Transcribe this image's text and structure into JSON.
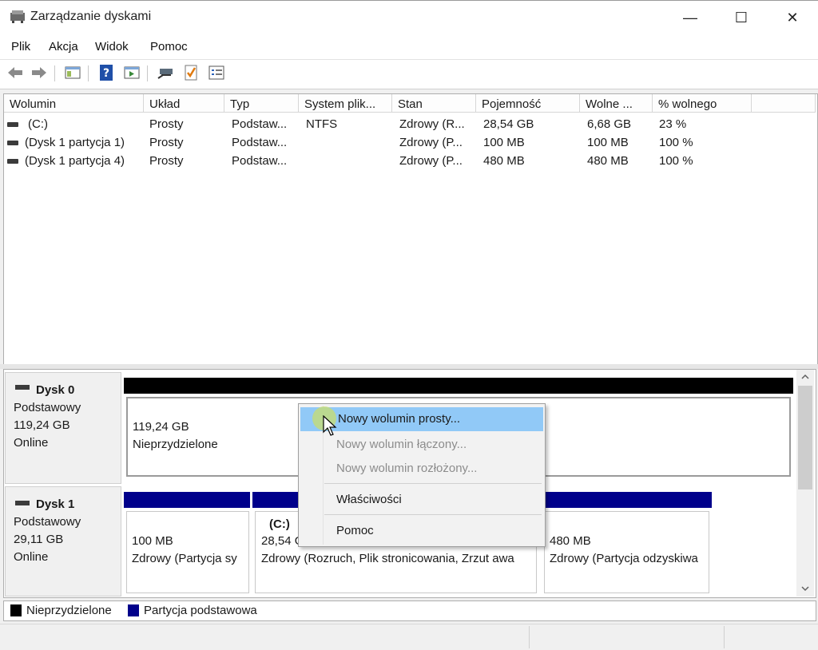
{
  "window": {
    "title": "Zarządzanie dyskami",
    "minimize": "—",
    "maximize": "☐",
    "close": "✕"
  },
  "menu": [
    "Plik",
    "Akcja",
    "Widok",
    "Pomoc"
  ],
  "toolbar_icons": [
    "back-arrow-icon",
    "forward-arrow-icon",
    "console-tree-icon",
    "help-icon",
    "action-pane-icon",
    "connect-icon",
    "check-icon",
    "properties-icon"
  ],
  "table": {
    "columns": [
      "Wolumin",
      "Układ",
      "Typ",
      "System plik...",
      "Stan",
      "Pojemność",
      "Wolne ...",
      "% wolnego"
    ],
    "rows": [
      [
        "(C:)",
        "Prosty",
        "Podstaw...",
        "NTFS",
        "Zdrowy (R...",
        "28,54 GB",
        "6,68 GB",
        "23 %"
      ],
      [
        "(Dysk 1 partycja 1)",
        "Prosty",
        "Podstaw...",
        "",
        "Zdrowy (P...",
        "100 MB",
        "100 MB",
        "100 %"
      ],
      [
        "(Dysk 1 partycja 4)",
        "Prosty",
        "Podstaw...",
        "",
        "Zdrowy (P...",
        "480 MB",
        "480 MB",
        "100 %"
      ]
    ]
  },
  "disks": [
    {
      "name": "Dysk 0",
      "type": "Podstawowy",
      "size": "119,24 GB",
      "status": "Online",
      "partitions": [
        {
          "size": "119,24 GB",
          "label": "Nieprzydzielone"
        }
      ]
    },
    {
      "name": "Dysk 1",
      "type": "Podstawowy",
      "size": "29,11 GB",
      "status": "Online",
      "partitions": [
        {
          "title": "",
          "size": "100 MB",
          "status": "Zdrowy (Partycja sy"
        },
        {
          "title": "(C:)",
          "size": "28,54 G",
          "status": "Zdrowy (Rozruch, Plik stronicowania, Zrzut awa"
        },
        {
          "title": "",
          "size": "480 MB",
          "status": "Zdrowy (Partycja odzyskiwa"
        }
      ]
    }
  ],
  "legend": {
    "unallocated": "Nieprzydzielone",
    "primary": "Partycja podstawowa"
  },
  "context_menu": {
    "items": [
      {
        "label": "Nowy wolumin prosty...",
        "enabled": true,
        "highlighted": true
      },
      {
        "label": "Nowy wolumin łączony...",
        "enabled": false
      },
      {
        "label": "Nowy wolumin rozłożony...",
        "enabled": false
      },
      {
        "label": "Właściwości",
        "enabled": true
      },
      {
        "label": "Pomoc",
        "enabled": true
      }
    ]
  },
  "colors": {
    "unallocated": "#000000",
    "primary": "#00008b",
    "highlight": "#91c9f7",
    "disabled_text": "#8c8c8c"
  }
}
